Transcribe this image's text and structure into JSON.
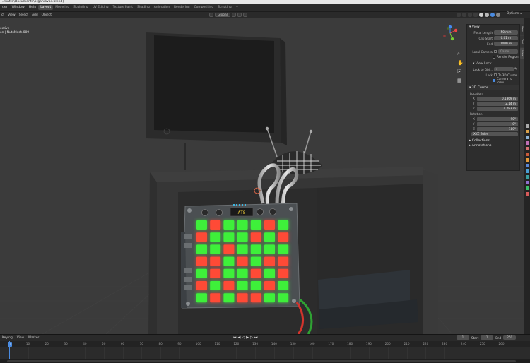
{
  "window": {
    "title": "...rnatte\\Documents\\organdivas.blend]"
  },
  "menubar": {
    "items": [
      "der",
      "Window",
      "Help"
    ],
    "workspaces": [
      "Layout",
      "Modeling",
      "Sculpting",
      "UV Editing",
      "Texture Paint",
      "Shading",
      "Animation",
      "Rendering",
      "Compositing",
      "Scripting"
    ],
    "active_workspace": "Layout",
    "add_tab": "+",
    "options": "Options ⌄"
  },
  "header": {
    "items": [
      "ct",
      "View",
      "Select",
      "Add",
      "Object"
    ],
    "transform": "Global"
  },
  "viewport": {
    "overlay_line1": "ective",
    "overlay_line2": "on | NutsMesh.009"
  },
  "npanel": {
    "tabs": [
      "Item",
      "Tool",
      "View"
    ],
    "view": {
      "title": "View",
      "focal_length_label": "Focal Length",
      "focal_length": "50 mm",
      "clip_start_label": "Clip Start",
      "clip_start": "0.01 m",
      "end_label": "End",
      "end": "1000 m",
      "local_camera_label": "Local Camera",
      "local_camera": "Came...",
      "render_region": "Render Region"
    },
    "view_lock": {
      "title": "View Lock",
      "lock_to_object_label": "Lock to Obj...",
      "lock_label": "Lock",
      "to_3d_cursor": "To 3D Cursor",
      "camera_to_view": "Camera to View"
    },
    "cursor": {
      "title": "3D Cursor",
      "location_label": "Location",
      "location": [
        {
          "axis": "X",
          "value": "0.1369 m"
        },
        {
          "axis": "Y",
          "value": "2.14 m"
        },
        {
          "axis": "Z",
          "value": "4.783 m"
        }
      ],
      "rotation_label": "Rotation",
      "rotation": [
        {
          "axis": "X",
          "value": "90°"
        },
        {
          "axis": "Y",
          "value": "0°"
        },
        {
          "axis": "Z",
          "value": "180°"
        }
      ],
      "euler": "XYZ Euler"
    },
    "collections": "Collections",
    "annotations": "Annotations"
  },
  "timeline": {
    "menu": [
      "Keying",
      "View",
      "Marker"
    ],
    "current_frame": "1",
    "start_label": "Start",
    "start": "1",
    "end_label": "End",
    "end": "250",
    "ruler": [
      "1",
      "10",
      "20",
      "30",
      "40",
      "50",
      "60",
      "70",
      "80",
      "90",
      "100",
      "110",
      "120",
      "130",
      "140",
      "150",
      "160",
      "170",
      "180",
      "190",
      "200",
      "210",
      "220",
      "230",
      "240",
      "250",
      "260"
    ]
  },
  "pad": {
    "display": "ATS",
    "grid": [
      [
        "g",
        "r",
        "g",
        "g",
        "g",
        "r",
        "g"
      ],
      [
        "r",
        "g",
        "g",
        "g",
        "r",
        "g",
        "r"
      ],
      [
        "g",
        "g",
        "r",
        "g",
        "g",
        "g",
        "g"
      ],
      [
        "r",
        "r",
        "g",
        "r",
        "g",
        "r",
        "r"
      ],
      [
        "g",
        "r",
        "g",
        "g",
        "r",
        "g",
        "r"
      ],
      [
        "r",
        "g",
        "r",
        "g",
        "g",
        "r",
        "g"
      ],
      [
        "g",
        "r",
        "g",
        "r",
        "r",
        "g",
        "g"
      ]
    ],
    "colors": {
      "green": "#3ef03a",
      "red": "#ff4a36",
      "pad_body": "#4b4f52"
    }
  },
  "colors": {
    "accent": "#4a8be0",
    "viewport_bg": "#3b3b3b",
    "panel_bg": "#2d2d2d"
  }
}
